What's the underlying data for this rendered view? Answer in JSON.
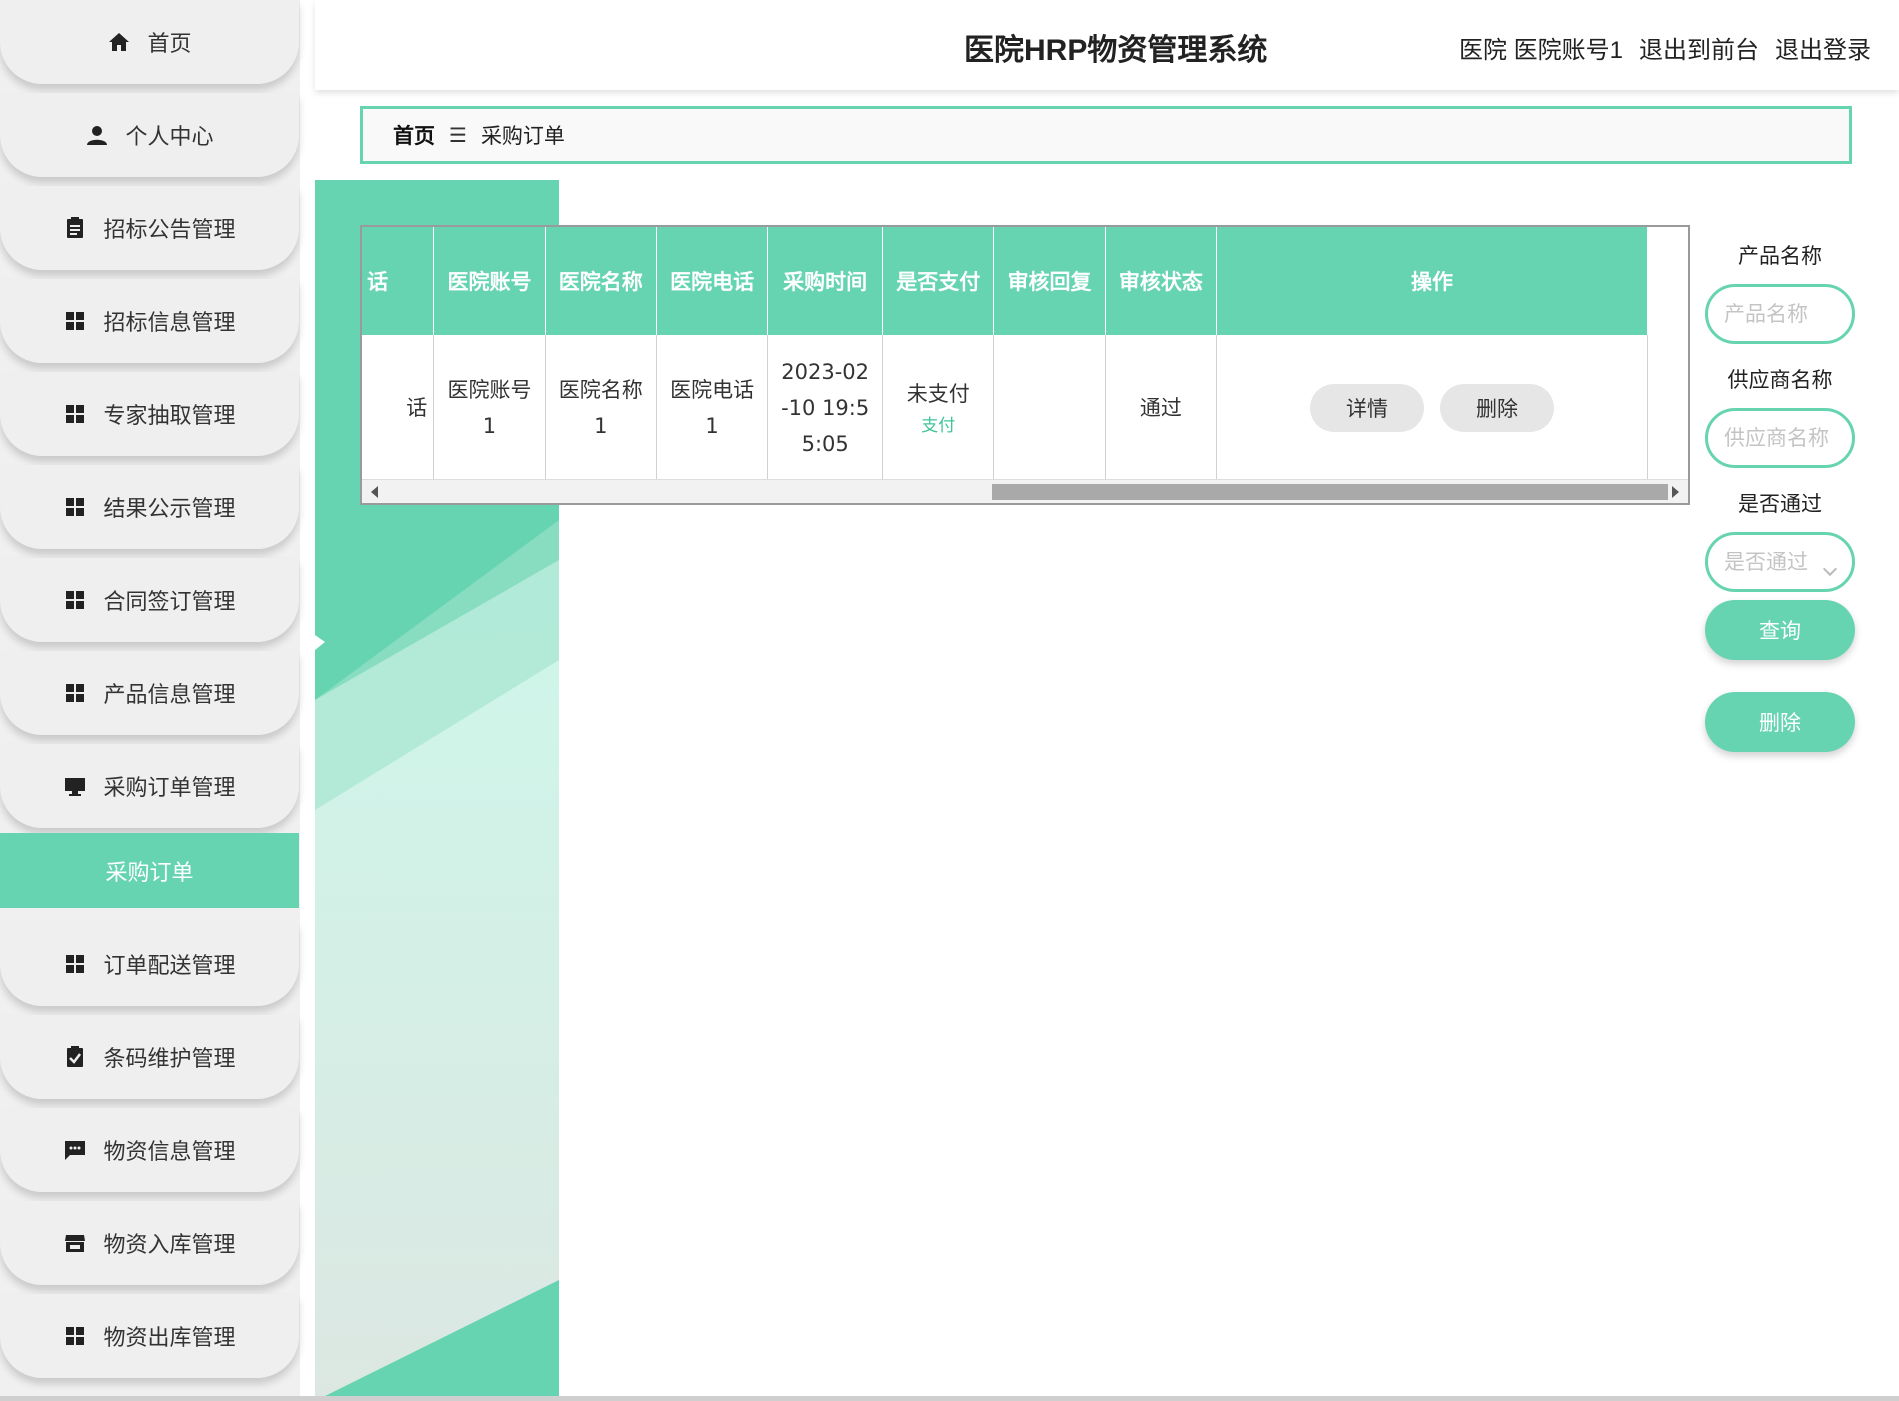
{
  "sidebar": {
    "items": [
      {
        "label": "首页",
        "icon": "home-icon"
      },
      {
        "label": "个人中心",
        "icon": "person-icon"
      },
      {
        "label": "招标公告管理",
        "icon": "clipboard-icon"
      },
      {
        "label": "招标信息管理",
        "icon": "grid-icon"
      },
      {
        "label": "专家抽取管理",
        "icon": "grid-icon"
      },
      {
        "label": "结果公示管理",
        "icon": "grid-icon"
      },
      {
        "label": "合同签订管理",
        "icon": "grid-icon"
      },
      {
        "label": "产品信息管理",
        "icon": "grid-icon"
      },
      {
        "label": "采购订单管理",
        "icon": "monitor-icon"
      },
      {
        "label": "订单配送管理",
        "icon": "grid-icon"
      },
      {
        "label": "条码维护管理",
        "icon": "clipboard-check-icon"
      },
      {
        "label": "物资信息管理",
        "icon": "chat-icon"
      },
      {
        "label": "物资入库管理",
        "icon": "storefront-icon"
      },
      {
        "label": "物资出库管理",
        "icon": "grid-icon"
      }
    ],
    "active_sub": "采购订单"
  },
  "header": {
    "title": "医院HRP物资管理系统",
    "user": "医院 医院账号1",
    "back_to_front": "退出到前台",
    "logout": "退出登录"
  },
  "breadcrumb": {
    "home": "首页",
    "separator": "☰",
    "current": "采购订单"
  },
  "table": {
    "columns": [
      "话",
      "医院账号",
      "医院名称",
      "医院电话",
      "采购时间",
      "是否支付",
      "审核回复",
      "审核状态",
      "操作"
    ],
    "rows": [
      {
        "phone_fragment": "话",
        "account": "医院账号1",
        "account_line1": "医院账号",
        "account_line2": "1",
        "name_line1": "医院名称",
        "name_line2": "1",
        "tel_line1": "医院电话",
        "tel_line2": "1",
        "time_line1": "2023-02",
        "time_line2": "-10 19:5",
        "time_line3": "5:05",
        "paid": "未支付",
        "pay_link": "支付",
        "reply": "",
        "status": "通过",
        "detail_btn": "详情",
        "delete_btn": "删除"
      }
    ]
  },
  "search": {
    "product_label": "产品名称",
    "product_placeholder": "产品名称",
    "supplier_label": "供应商名称",
    "supplier_placeholder": "供应商名称",
    "pass_label": "是否通过",
    "pass_placeholder": "是否通过",
    "query_btn": "查询",
    "delete_btn": "删除"
  },
  "colors": {
    "accent": "#66d4b1",
    "sidebar_bg": "#efefef",
    "pill_bg": "#e6e6e6"
  }
}
